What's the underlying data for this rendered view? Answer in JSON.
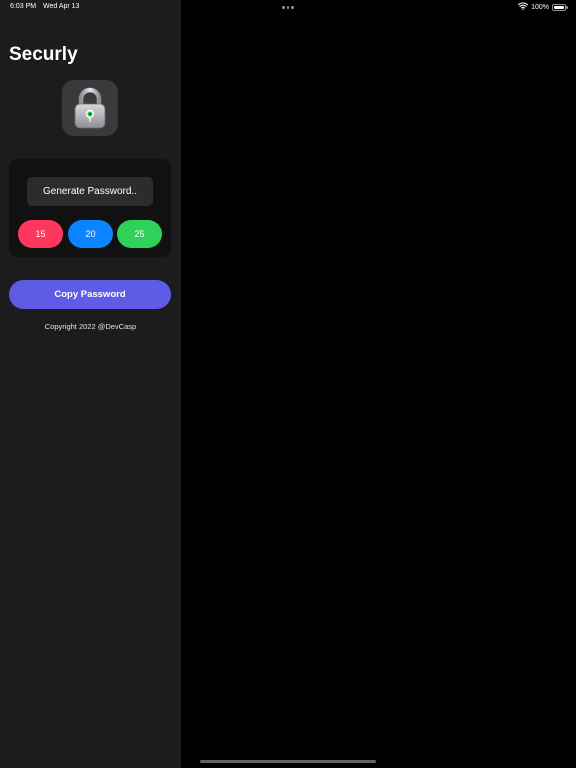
{
  "status_bar": {
    "time": "6:03 PM",
    "date": "Wed Apr 13",
    "battery_percent": "100%",
    "battery_level": 1.0
  },
  "sidebar": {
    "title": "Securly",
    "icon": "padlock-icon",
    "generate_label": "Generate Password..",
    "length_options": [
      {
        "label": "15",
        "color": "#ff375f"
      },
      {
        "label": "20",
        "color": "#0a84ff"
      },
      {
        "label": "25",
        "color": "#30d158"
      }
    ],
    "copy_label": "Copy Password",
    "copy_color": "#5e5ce6",
    "copyright": "Copyright 2022 @DevCasp"
  },
  "colors": {
    "sidebar_bg": "#1c1c1e",
    "detail_bg": "#000000",
    "card_bg": "#111112"
  }
}
